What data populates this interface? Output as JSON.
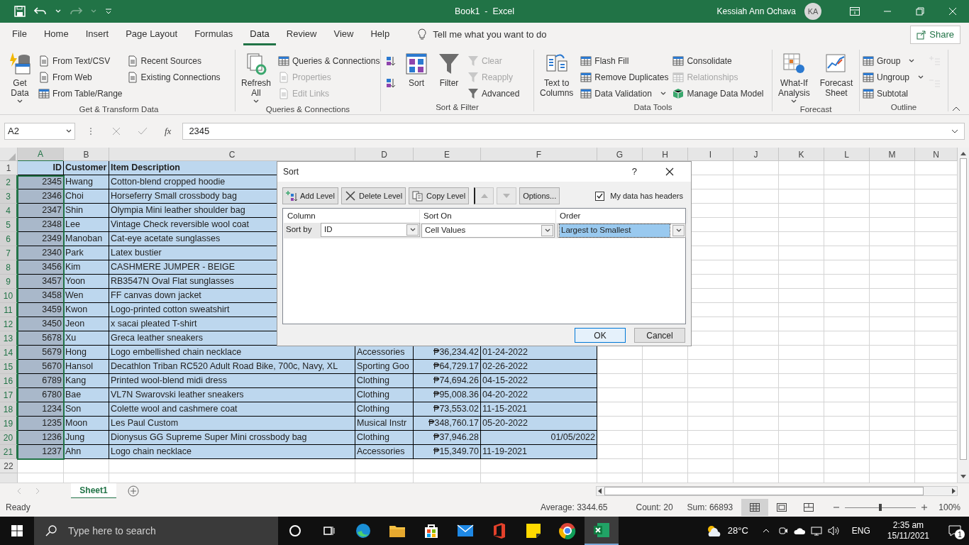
{
  "title_bar": {
    "title": "Book1  -  Excel",
    "user": "Kessiah Ann Ochava",
    "avatar": "KA"
  },
  "menu_tabs": [
    {
      "label": "File",
      "selected": false
    },
    {
      "label": "Home",
      "selected": false
    },
    {
      "label": "Insert",
      "selected": false
    },
    {
      "label": "Page Layout",
      "selected": false
    },
    {
      "label": "Formulas",
      "selected": false
    },
    {
      "label": "Data",
      "selected": true
    },
    {
      "label": "Review",
      "selected": false
    },
    {
      "label": "View",
      "selected": false
    },
    {
      "label": "Help",
      "selected": false
    }
  ],
  "tell_me": "Tell me what you want to do",
  "share": "Share",
  "ribbon": [
    {
      "name": "Get & Transform Data",
      "columns": [
        [
          {
            "kind": "large",
            "label": "Get Data",
            "dropdown": true,
            "disabled": false
          }
        ],
        [
          {
            "kind": "small",
            "label": "From Text/CSV",
            "dropdown": false,
            "disabled": false
          },
          {
            "kind": "small",
            "label": "From Web",
            "dropdown": false,
            "disabled": false
          },
          {
            "kind": "small",
            "label": "From Table/Range",
            "dropdown": false,
            "disabled": false
          }
        ],
        [
          {
            "kind": "small",
            "label": "Recent Sources",
            "dropdown": false,
            "disabled": false
          },
          {
            "kind": "small",
            "label": "Existing Connections",
            "dropdown": false,
            "disabled": false
          }
        ]
      ]
    },
    {
      "name": "Queries & Connections",
      "columns": [
        [
          {
            "kind": "large",
            "label": "Refresh All",
            "dropdown": true,
            "disabled": false
          }
        ],
        [
          {
            "kind": "small",
            "label": "Queries & Connections",
            "dropdown": false,
            "disabled": false
          },
          {
            "kind": "small",
            "label": "Properties",
            "dropdown": false,
            "disabled": true
          },
          {
            "kind": "small",
            "label": "Edit Links",
            "dropdown": false,
            "disabled": true
          }
        ]
      ]
    },
    {
      "name": "Sort & Filter",
      "columns": [
        [
          {
            "kind": "icon",
            "disabled": false
          },
          {
            "kind": "icon",
            "disabled": false
          }
        ],
        [
          {
            "kind": "large",
            "label": "Sort",
            "dropdown": false,
            "disabled": false
          }
        ],
        [
          {
            "kind": "large",
            "label": "Filter",
            "dropdown": false,
            "disabled": false
          }
        ],
        [
          {
            "kind": "small",
            "label": "Clear",
            "dropdown": false,
            "disabled": true
          },
          {
            "kind": "small",
            "label": "Reapply",
            "dropdown": false,
            "disabled": true
          },
          {
            "kind": "small",
            "label": "Advanced",
            "dropdown": false,
            "disabled": false
          }
        ]
      ]
    },
    {
      "name": "Data Tools",
      "columns": [
        [
          {
            "kind": "large",
            "label": "Text to Columns",
            "dropdown": false,
            "disabled": false
          }
        ],
        [
          {
            "kind": "small",
            "label": "Flash Fill",
            "dropdown": false,
            "disabled": false
          },
          {
            "kind": "small",
            "label": "Remove Duplicates",
            "dropdown": false,
            "disabled": false
          },
          {
            "kind": "small",
            "label": "Data Validation",
            "dropdown": true,
            "disabled": false
          }
        ],
        [
          {
            "kind": "small",
            "label": "Consolidate",
            "dropdown": false,
            "disabled": false
          },
          {
            "kind": "small",
            "label": "Relationships",
            "dropdown": false,
            "disabled": true
          },
          {
            "kind": "small",
            "label": "Manage Data Model",
            "dropdown": false,
            "disabled": false
          }
        ]
      ]
    },
    {
      "name": "Forecast",
      "columns": [
        [
          {
            "kind": "large",
            "label": "What-If Analysis",
            "dropdown": true,
            "disabled": false
          }
        ],
        [
          {
            "kind": "large",
            "label": "Forecast Sheet",
            "dropdown": false,
            "disabled": false
          }
        ]
      ]
    },
    {
      "name": "Outline",
      "columns": [
        [
          {
            "kind": "small",
            "label": "Group",
            "dropdown": true,
            "disabled": false
          },
          {
            "kind": "small",
            "label": "Ungroup",
            "dropdown": true,
            "disabled": false
          },
          {
            "kind": "small",
            "label": "Subtotal",
            "dropdown": false,
            "disabled": false
          }
        ],
        [
          {
            "kind": "icon",
            "disabled": true
          },
          {
            "kind": "icon",
            "disabled": true
          }
        ]
      ]
    }
  ],
  "formula_bar": {
    "name_box": "A2",
    "fx": "fx",
    "value": "2345"
  },
  "sheet": {
    "columns": [
      {
        "letter": "A",
        "selected": true
      },
      {
        "letter": "B",
        "selected": false
      },
      {
        "letter": "C",
        "selected": false
      },
      {
        "letter": "D",
        "selected": false
      },
      {
        "letter": "E",
        "selected": false
      },
      {
        "letter": "F",
        "selected": false
      },
      {
        "letter": "G",
        "selected": false
      },
      {
        "letter": "H",
        "selected": false
      },
      {
        "letter": "I",
        "selected": false
      },
      {
        "letter": "J",
        "selected": false
      },
      {
        "letter": "K",
        "selected": false
      },
      {
        "letter": "L",
        "selected": false
      },
      {
        "letter": "M",
        "selected": false
      },
      {
        "letter": "N",
        "selected": false
      }
    ],
    "rows": [
      {
        "number": "1",
        "selected": false,
        "cells": [
          "ID",
          "Customer",
          "Item Description"
        ]
      },
      {
        "number": "2",
        "selected": true,
        "cells": [
          "2345",
          "Hwang",
          "Cotton-blend cropped hoodie"
        ]
      },
      {
        "number": "3",
        "selected": true,
        "cells": [
          "2346",
          "Choi",
          "Horseferry Small crossbody bag"
        ]
      },
      {
        "number": "4",
        "selected": true,
        "cells": [
          "2347",
          "Shin",
          "Olympia Mini leather shoulder bag"
        ]
      },
      {
        "number": "5",
        "selected": true,
        "cells": [
          "2348",
          "Lee",
          "Vintage Check reversible wool coat"
        ]
      },
      {
        "number": "6",
        "selected": true,
        "cells": [
          "2349",
          "Manoban",
          "Cat-eye acetate sunglasses"
        ]
      },
      {
        "number": "7",
        "selected": true,
        "cells": [
          "2340",
          "Park",
          "Latex bustier"
        ]
      },
      {
        "number": "8",
        "selected": true,
        "cells": [
          "3456",
          "Kim",
          "CASHMERE JUMPER - BEIGE"
        ]
      },
      {
        "number": "9",
        "selected": true,
        "cells": [
          "3457",
          "Yoon",
          "RB3547N Oval Flat sunglasses"
        ]
      },
      {
        "number": "10",
        "selected": true,
        "cells": [
          "3458",
          "Wen",
          "FF canvas down jacket"
        ]
      },
      {
        "number": "11",
        "selected": true,
        "cells": [
          "3459",
          "Kwon",
          "Logo-printed cotton sweatshirt"
        ]
      },
      {
        "number": "12",
        "selected": true,
        "cells": [
          "3450",
          "Jeon",
          "x sacai pleated T-shirt"
        ]
      },
      {
        "number": "13",
        "selected": true,
        "cells": [
          "5678",
          "Xu",
          "Greca leather sneakers"
        ]
      },
      {
        "number": "14",
        "selected": true,
        "cells": [
          "5679",
          "Hong",
          "Logo embellished chain necklace",
          "Accessories",
          "₱36,234.42",
          "01-24-2022"
        ]
      },
      {
        "number": "15",
        "selected": true,
        "cells": [
          "5670",
          "Hansol",
          "Decathlon Triban RC520 Adult Road Bike, 700c, Navy, XL",
          "Sporting Goo",
          "₱64,729.17",
          "02-26-2022"
        ]
      },
      {
        "number": "16",
        "selected": true,
        "cells": [
          "6789",
          "Kang",
          "Printed wool-blend midi dress",
          "Clothing",
          "₱74,694.26",
          "04-15-2022"
        ]
      },
      {
        "number": "17",
        "selected": true,
        "cells": [
          "6780",
          "Bae",
          "VL7N Swarovski leather sneakers",
          "Clothing",
          "₱95,008.36",
          "04-20-2022"
        ]
      },
      {
        "number": "18",
        "selected": true,
        "cells": [
          "1234",
          "Son",
          "Colette wool and cashmere coat",
          "Clothing",
          "₱73,553.02",
          "11-15-2021"
        ]
      },
      {
        "number": "19",
        "selected": true,
        "cells": [
          "1235",
          "Moon",
          "Les Paul Custom",
          "Musical Instr",
          "₱348,760.17",
          "05-20-2022"
        ]
      },
      {
        "number": "20",
        "selected": true,
        "cells": [
          "1236",
          "Jung",
          "Dionysus GG Supreme Super Mini crossbody bag",
          "Clothing",
          "₱37,946.28",
          {
            "text": "01/05/2022",
            "right_aligned": true
          }
        ]
      },
      {
        "number": "21",
        "selected": true,
        "cells": [
          "1237",
          "Ahn",
          "Logo chain necklace",
          "Accessories",
          "₱15,349.70",
          "11-19-2021"
        ]
      },
      {
        "number": "22",
        "selected": false,
        "cells": []
      }
    ]
  },
  "dialog": {
    "title": "Sort",
    "help": "?",
    "toolbar": [
      {
        "kind": "text",
        "label": "Add Level",
        "disabled": false
      },
      {
        "kind": "text",
        "label": "Delete Level",
        "disabled": false
      },
      {
        "kind": "text",
        "label": "Copy Level",
        "disabled": false
      },
      {
        "kind": "up",
        "disabled": true
      },
      {
        "kind": "down",
        "disabled": true
      },
      {
        "kind": "text",
        "label": "Options...",
        "disabled": false
      }
    ],
    "headers_checkbox": {
      "label": "My data has headers",
      "checked": true
    },
    "columns": [
      "Column",
      "Sort On",
      "Order"
    ],
    "levels": [
      {
        "label": "Sort by",
        "fields": [
          {
            "value": "ID",
            "selected": false
          },
          {
            "value": "Cell Values",
            "selected": false
          },
          {
            "value": "Largest to Smallest",
            "selected": true
          }
        ]
      }
    ],
    "ok": "OK",
    "cancel": "Cancel"
  },
  "sheet_tabs": [
    {
      "label": "Sheet1",
      "selected": true
    }
  ],
  "status_bar": {
    "mode": "Ready",
    "average": "Average: 3344.65",
    "count": "Count: 20",
    "sum": "Sum: 66893",
    "views": [
      {
        "selected": true
      },
      {
        "selected": false
      },
      {
        "selected": false
      }
    ],
    "zoom": {
      "level": 0.5
    },
    "zoom_text": "100%"
  },
  "taskbar": {
    "search_placeholder": "Type here to search",
    "apps": [
      {
        "selected": false
      },
      {
        "selected": false
      },
      {
        "selected": false
      },
      {
        "selected": false
      },
      {
        "selected": false
      },
      {
        "selected": false
      },
      {
        "selected": false
      },
      {
        "selected": false
      },
      {
        "selected": false
      },
      {
        "selected": true
      }
    ],
    "temperature": "28°C",
    "language": "ENG",
    "time": "2:35 am",
    "date": "15/11/2021",
    "notifications": "1"
  }
}
